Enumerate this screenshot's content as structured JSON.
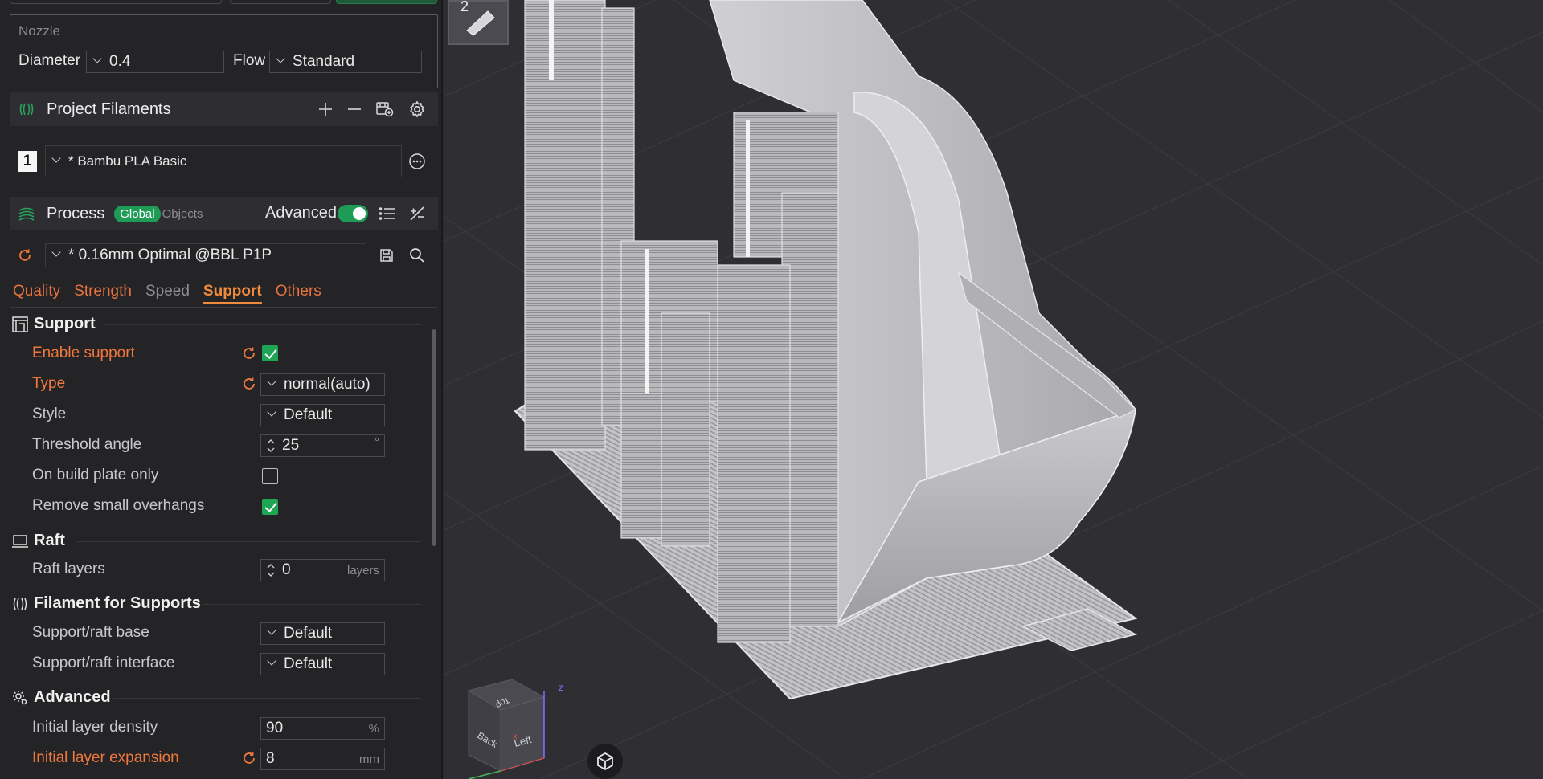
{
  "nozzle": {
    "section_label": "Nozzle",
    "diameter_label": "Diameter",
    "diameter_value": "0.4",
    "flow_label": "Flow",
    "flow_value": "Standard"
  },
  "filaments": {
    "header": "Project Filaments",
    "items": [
      {
        "index": "1",
        "name": "* Bambu PLA Basic"
      }
    ]
  },
  "process": {
    "header": "Process",
    "global_badge": "Global",
    "objects_badge": "Objects",
    "advanced_label": "Advanced",
    "advanced_on": true,
    "preset": "* 0.16mm Optimal @BBL P1P"
  },
  "tabs": [
    {
      "label": "Quality",
      "state": "normal"
    },
    {
      "label": "Strength",
      "state": "normal"
    },
    {
      "label": "Speed",
      "state": "dim"
    },
    {
      "label": "Support",
      "state": "active"
    },
    {
      "label": "Others",
      "state": "normal"
    }
  ],
  "support": {
    "section": "Support",
    "enable_label": "Enable support",
    "enable_value": true,
    "type_label": "Type",
    "type_value": "normal(auto)",
    "style_label": "Style",
    "style_value": "Default",
    "threshold_label": "Threshold angle",
    "threshold_value": "25",
    "threshold_unit": "°",
    "build_plate_label": "On build plate only",
    "build_plate_value": false,
    "small_overhangs_label": "Remove small overhangs",
    "small_overhangs_value": true
  },
  "raft": {
    "section": "Raft",
    "layers_label": "Raft layers",
    "layers_value": "0",
    "layers_unit": "layers"
  },
  "filament_supports": {
    "section": "Filament for Supports",
    "base_label": "Support/raft base",
    "base_value": "Default",
    "interface_label": "Support/raft interface",
    "interface_value": "Default"
  },
  "advanced": {
    "section": "Advanced",
    "density_label": "Initial layer density",
    "density_value": "90",
    "density_unit": "%",
    "expansion_label": "Initial layer expansion",
    "expansion_value": "8",
    "expansion_unit": "mm"
  },
  "viewport": {
    "plate_number": "2",
    "cube_top": "Top",
    "cube_back": "Back",
    "cube_left": "Left",
    "axis_z": "z",
    "axis_x": "x"
  },
  "colors": {
    "accent_green": "#1e9b55",
    "modified_orange": "#f0783c",
    "panel_bg": "#242427",
    "viewport_bg": "#2e2e33"
  }
}
